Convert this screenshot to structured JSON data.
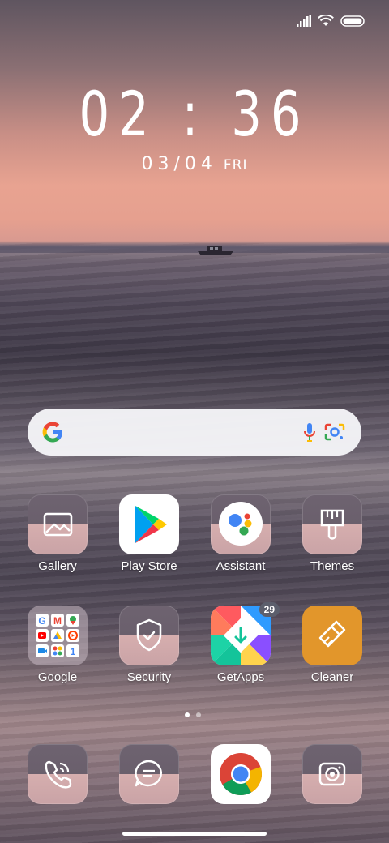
{
  "status_bar": {
    "icons": [
      "signal-icon",
      "wifi-icon",
      "battery-icon"
    ]
  },
  "clock": {
    "time": "02 : 36",
    "date": "03/04",
    "day": "FRI"
  },
  "search_bar": {
    "icons": [
      "google-logo-icon",
      "microphone-icon",
      "google-lens-icon"
    ]
  },
  "apps_row1": [
    {
      "label": "Gallery",
      "icon": "gallery-icon"
    },
    {
      "label": "Play Store",
      "icon": "play-store-icon"
    },
    {
      "label": "Assistant",
      "icon": "assistant-icon"
    },
    {
      "label": "Themes",
      "icon": "themes-brush-icon"
    }
  ],
  "apps_row2": [
    {
      "label": "Google",
      "icon": "google-folder-icon"
    },
    {
      "label": "Security",
      "icon": "security-shield-icon"
    },
    {
      "label": "GetApps",
      "icon": "getapps-icon",
      "badge": "29"
    },
    {
      "label": "Cleaner",
      "icon": "cleaner-brush-icon"
    }
  ],
  "dock": [
    {
      "icon": "phone-icon"
    },
    {
      "icon": "messages-icon"
    },
    {
      "icon": "chrome-icon"
    },
    {
      "icon": "camera-icon"
    }
  ],
  "page_indicator": {
    "pages": 2,
    "current": 1
  },
  "colors": {
    "accent_orange": "#e2962b",
    "tile_top": "#6e6370",
    "tile_bottom": "#d6aeae"
  }
}
